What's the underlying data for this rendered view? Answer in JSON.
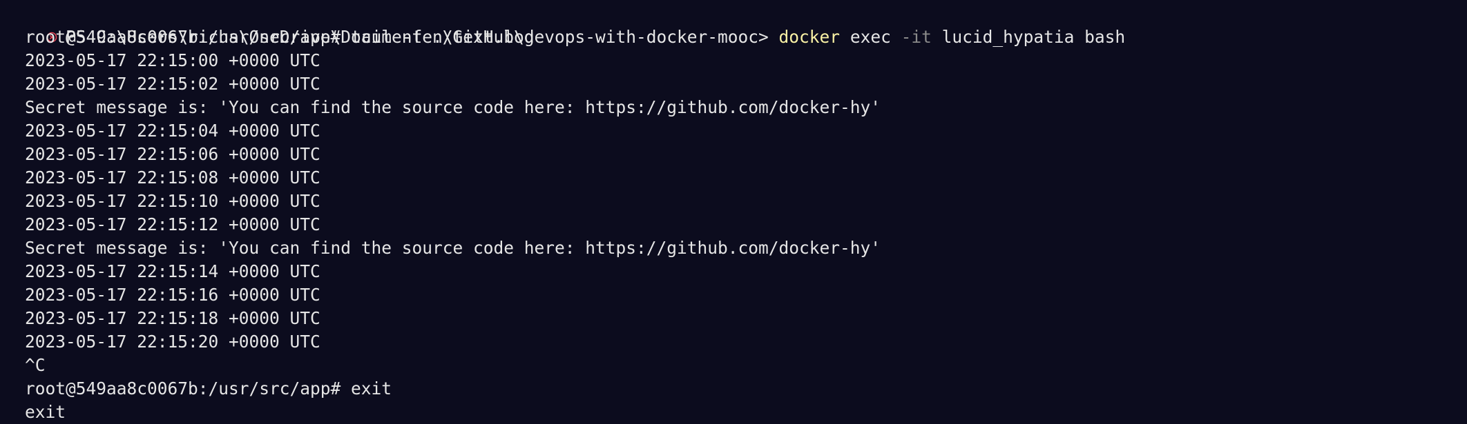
{
  "terminal": {
    "background": "#0c0c1e",
    "foreground": "#e6e6e6",
    "command_color": "#f9f1a5",
    "flag_color": "#8a8a8a",
    "error_icon_color": "#e74856",
    "prompt": "PS C:\\Users\\richa\\OneDrive\\Documenten\\GitHub\\devops-with-docker-mooc> ",
    "command": {
      "name": "docker",
      "sub": " exec ",
      "flag": "-it",
      "args": " lucid_hypatia bash"
    },
    "lines": [
      "root@549aa8c0067b:/usr/src/app# tail -f ./text.log",
      "2023-05-17 22:15:00 +0000 UTC",
      "2023-05-17 22:15:02 +0000 UTC",
      "Secret message is: 'You can find the source code here: https://github.com/docker-hy'",
      "2023-05-17 22:15:04 +0000 UTC",
      "2023-05-17 22:15:06 +0000 UTC",
      "2023-05-17 22:15:08 +0000 UTC",
      "2023-05-17 22:15:10 +0000 UTC",
      "2023-05-17 22:15:12 +0000 UTC",
      "Secret message is: 'You can find the source code here: https://github.com/docker-hy'",
      "2023-05-17 22:15:14 +0000 UTC",
      "2023-05-17 22:15:16 +0000 UTC",
      "2023-05-17 22:15:18 +0000 UTC",
      "2023-05-17 22:15:20 +0000 UTC",
      "^C",
      "root@549aa8c0067b:/usr/src/app# exit",
      "exit"
    ]
  }
}
